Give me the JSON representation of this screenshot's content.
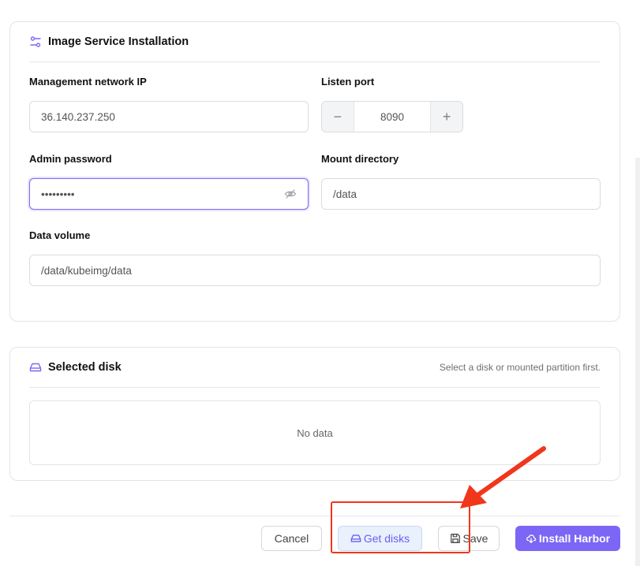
{
  "install": {
    "title": "Image Service Installation",
    "fields": {
      "mgmt_ip": {
        "label": "Management network IP",
        "value": "36.140.237.250"
      },
      "listen_port": {
        "label": "Listen port",
        "value": "8090",
        "minus": "−",
        "plus": "+"
      },
      "admin_password": {
        "label": "Admin password",
        "value": "•••••••••"
      },
      "mount_dir": {
        "label": "Mount directory",
        "value": "/data"
      },
      "data_volume": {
        "label": "Data volume",
        "value": "/data/kubeimg/data"
      }
    }
  },
  "disk": {
    "title": "Selected disk",
    "hint": "Select a disk or mounted partition first.",
    "empty_text": "No data"
  },
  "footer": {
    "cancel": "Cancel",
    "get_disks": "Get disks",
    "save": "Save",
    "install": "Install Harbor"
  },
  "colors": {
    "accent": "#7b66f5",
    "annotation": "#f0361b"
  },
  "icons": {
    "install_header": "sliders-icon",
    "disk_header": "hard-drive-icon",
    "password": "eye-off-icon",
    "get_disks": "hard-drive-icon",
    "save": "floppy-icon",
    "install": "cloud-download-icon"
  }
}
